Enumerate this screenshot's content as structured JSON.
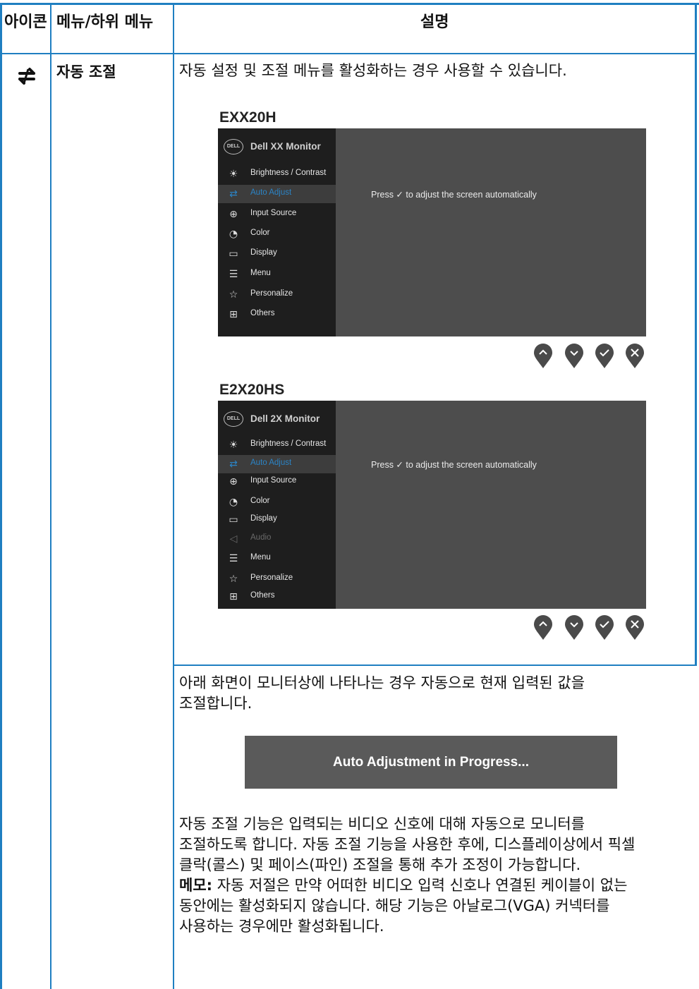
{
  "table": {
    "headers": {
      "icon": "아이콘",
      "menu": "메뉴/하위 메뉴",
      "desc": "설명"
    },
    "row": {
      "menu_label": "자동 조절",
      "intro": "자동 설정 및 조절 메뉴를 활성화하는 경우 사용할 수 있습니다.",
      "screen_intro_line1": "아래 화면이 모니터상에 나타나는 경우 자동으로 현재 입력된 값을",
      "screen_intro_line2": "조절합니다.",
      "progress_text": "Auto Adjustment in Progress...",
      "para": [
        "자동 조절 기능은 입력되는 비디오 신호에 대해 자동으로 모니터를",
        "조절하도록 합니다. 자동 조절 기능을 사용한 후에, 디스플레이상에서 픽셀",
        "클락(콜스) 및 페이스(파인) 조절을 통해 추가 조정이 가능합니다."
      ],
      "note_label": "메모:",
      "note_text_1": " 자동 저절은 만약 어떠한 비디오 입력 신호나 연결된 케이블이 없는",
      "note_text_2": "동안에는 활성화되지 않습니다. 해당 기능은 아날로그(VGA) 커넥터를",
      "note_text_3": "사용하는 경우에만 활성화됩니다."
    }
  },
  "osd1": {
    "model": "EXX20H",
    "logo": "DELL",
    "title": "Dell XX Monitor",
    "message": "Press ✓ to adjust the screen automatically",
    "items": [
      {
        "label": "Brightness / Contrast",
        "icon": "brightness-icon"
      },
      {
        "label": "Auto Adjust",
        "icon": "auto-adjust-icon"
      },
      {
        "label": "Input Source",
        "icon": "input-source-icon"
      },
      {
        "label": "Color",
        "icon": "color-icon"
      },
      {
        "label": "Display",
        "icon": "display-icon"
      },
      {
        "label": "Menu",
        "icon": "menu-icon"
      },
      {
        "label": "Personalize",
        "icon": "star-icon"
      },
      {
        "label": "Others",
        "icon": "others-icon"
      }
    ]
  },
  "osd2": {
    "model": "E2X20HS",
    "logo": "DELL",
    "title": "Dell 2X Monitor",
    "message": "Press ✓ to adjust the screen automatically",
    "items": [
      {
        "label": "Brightness / Contrast",
        "icon": "brightness-icon"
      },
      {
        "label": "Auto Adjust",
        "icon": "auto-adjust-icon"
      },
      {
        "label": "Input Source",
        "icon": "input-source-icon"
      },
      {
        "label": "Color",
        "icon": "color-icon"
      },
      {
        "label": "Display",
        "icon": "display-icon"
      },
      {
        "label": "Audio",
        "icon": "audio-icon"
      },
      {
        "label": "Menu",
        "icon": "menu-icon"
      },
      {
        "label": "Personalize",
        "icon": "star-icon"
      },
      {
        "label": "Others",
        "icon": "others-icon"
      }
    ]
  },
  "colors": {
    "border": "#1f7fc1",
    "osd_bg": "#4d4d4d",
    "osd_side": "#1e1e1e",
    "selected": "#2b84c6"
  }
}
